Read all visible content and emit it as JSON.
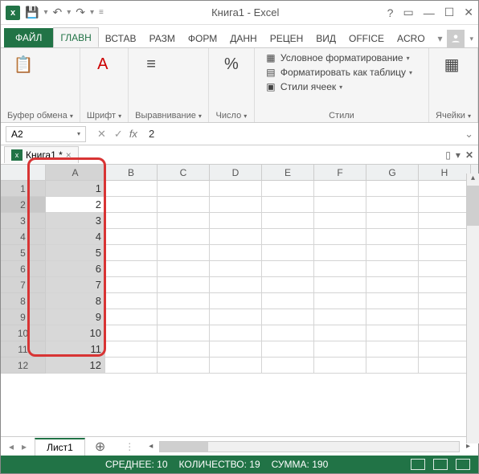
{
  "title": "Книга1 - Excel",
  "qat": {
    "save": "save-icon",
    "undo": "undo-icon",
    "redo": "redo-icon"
  },
  "tabs": {
    "file": "ФАЙЛ",
    "list": [
      "ГЛАВН",
      "ВСТАВ",
      "РАЗМ",
      "ФОРМ",
      "ДАНН",
      "РЕЦЕН",
      "ВИД",
      "OFFICE",
      "ACRO"
    ],
    "active": 0
  },
  "ribbon": {
    "clipboard": {
      "label": "Буфер обмена"
    },
    "font": {
      "label": "Шрифт"
    },
    "align": {
      "label": "Выравнивание"
    },
    "number": {
      "label": "Число"
    },
    "styles": {
      "cond": "Условное форматирование",
      "table": "Форматировать как таблицу",
      "cell": "Стили ячеек",
      "label": "Стили"
    },
    "cells": {
      "label": "Ячейки"
    }
  },
  "namebox": "A2",
  "formula_value": "2",
  "fx": "fx",
  "workbook_tab": "Книга1 *",
  "columns": [
    "A",
    "B",
    "C",
    "D",
    "E",
    "F",
    "G",
    "H"
  ],
  "rows": [
    {
      "n": 1,
      "A": "1"
    },
    {
      "n": 2,
      "A": "2"
    },
    {
      "n": 3,
      "A": "3"
    },
    {
      "n": 4,
      "A": "4"
    },
    {
      "n": 5,
      "A": "5"
    },
    {
      "n": 6,
      "A": "6"
    },
    {
      "n": 7,
      "A": "7"
    },
    {
      "n": 8,
      "A": "8"
    },
    {
      "n": 9,
      "A": "9"
    },
    {
      "n": 10,
      "A": "10"
    },
    {
      "n": 11,
      "A": "11"
    },
    {
      "n": 12,
      "A": "12"
    }
  ],
  "active_row": 2,
  "sheet_tab": "Лист1",
  "status": {
    "avg_label": "СРЕДНЕЕ:",
    "avg": "10",
    "count_label": "КОЛИЧЕСТВО:",
    "count": "19",
    "sum_label": "СУММА:",
    "sum": "190"
  }
}
